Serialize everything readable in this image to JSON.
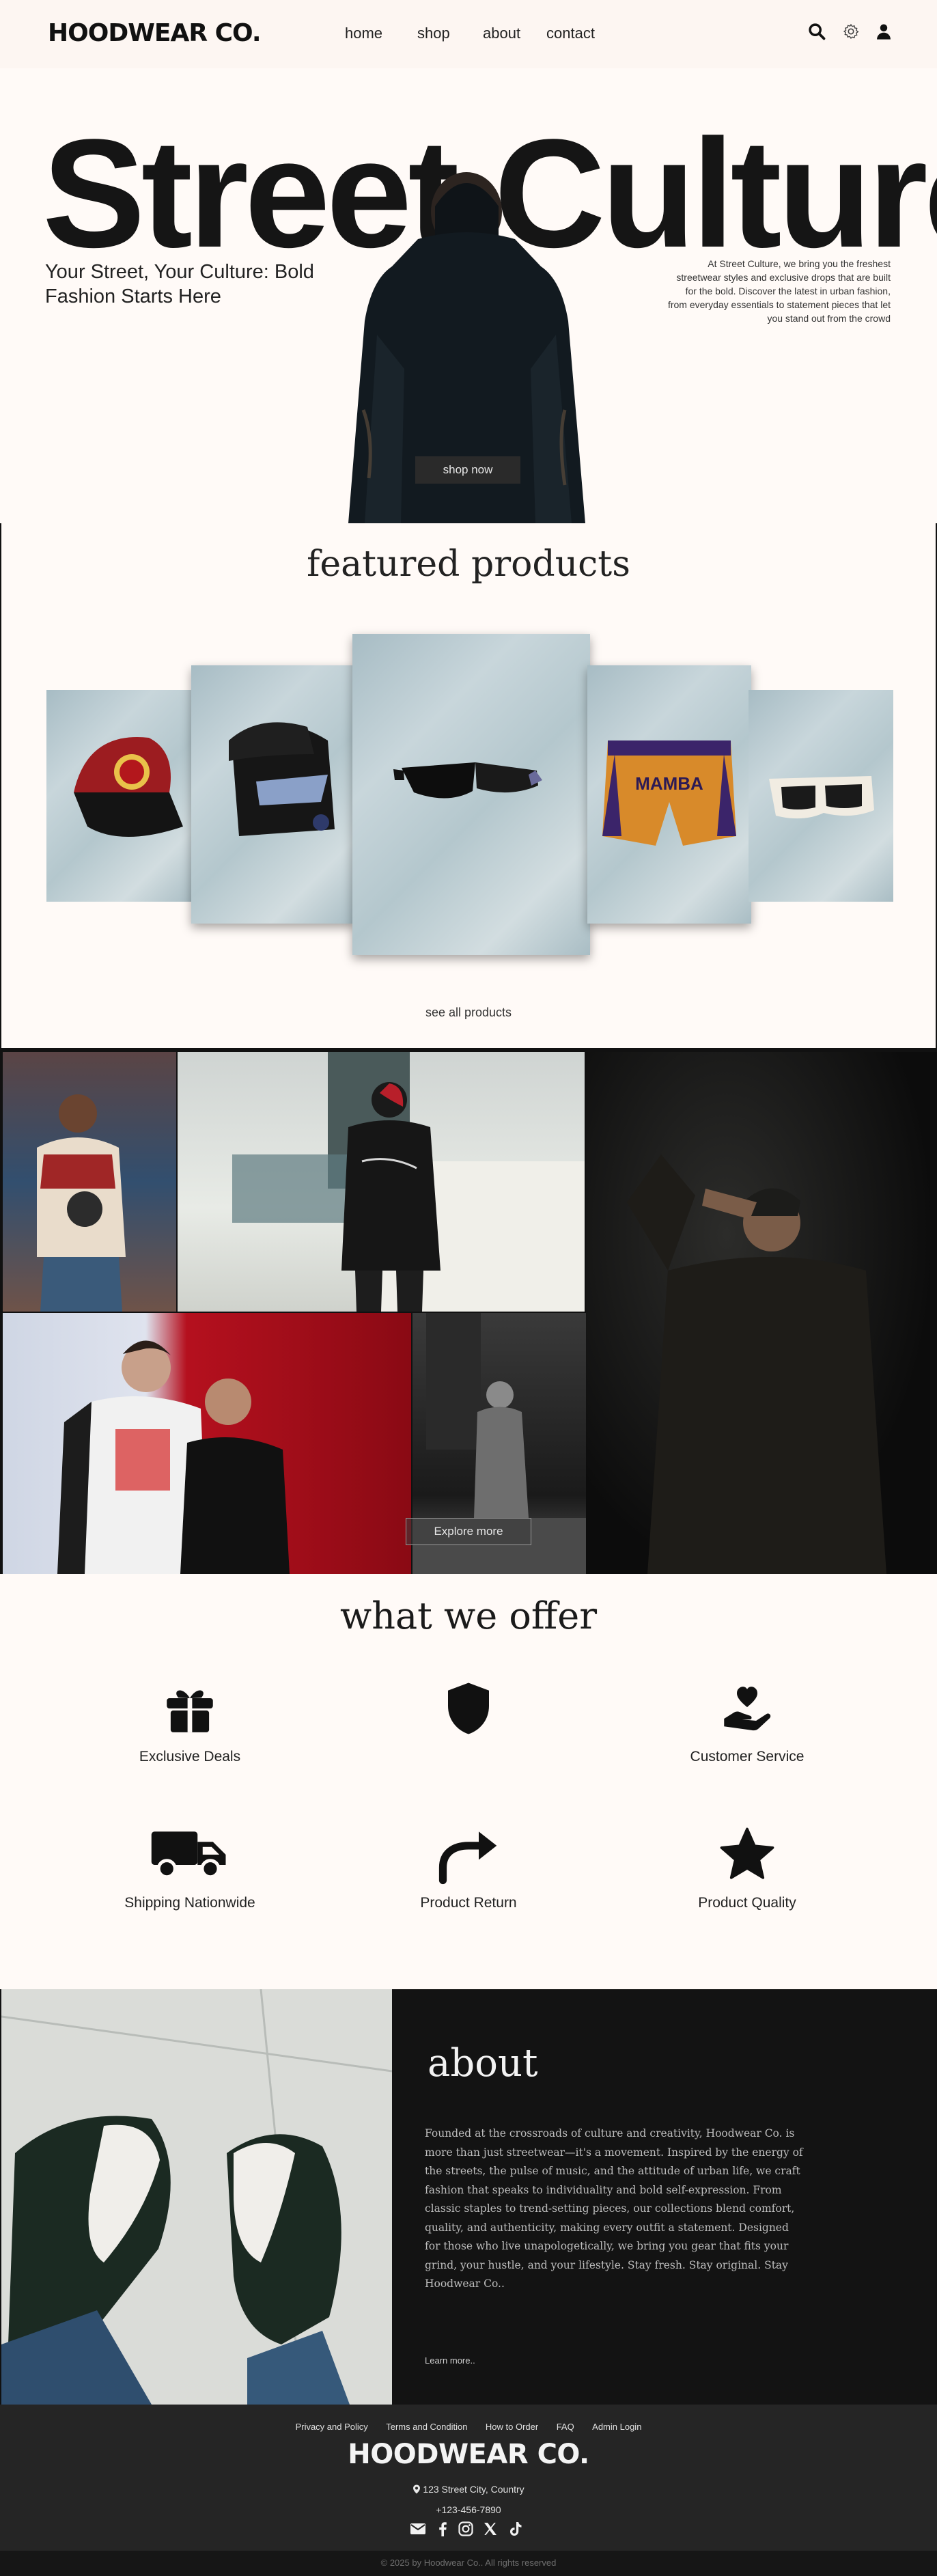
{
  "nav": {
    "brand": "HOODWEAR CO.",
    "links": [
      "home",
      "shop",
      "about",
      "contact"
    ],
    "icons": [
      "search-icon",
      "settings-icon",
      "user-icon"
    ]
  },
  "hero": {
    "title": "Street Culture",
    "subtitle": "Your Street, Your Culture: Bold Fashion Starts Here",
    "description": "At Street Culture, we bring you the freshest streetwear styles and exclusive drops that are built for the bold. Discover the latest in urban fashion, from everyday essentials to statement pieces that let you stand out from the crowd",
    "button": "shop now"
  },
  "featured": {
    "title": "featured products",
    "products": [
      "red snapback cap",
      "black snapback cap",
      "black sunglasses",
      "purple and orange basketball shorts",
      "white sunglasses"
    ],
    "see_all": "see all products"
  },
  "gallery": {
    "button": "Explore more"
  },
  "offer": {
    "title": "what we offer",
    "items": [
      {
        "label": "Exclusive Deals",
        "icon": "gift-icon"
      },
      {
        "label": "",
        "icon": "shield-icon"
      },
      {
        "label": "Customer Service",
        "icon": "heart-hand-icon"
      },
      {
        "label": "Shipping Nationwide",
        "icon": "truck-icon"
      },
      {
        "label": "Product Return",
        "icon": "return-arrow-icon"
      },
      {
        "label": "Product Quality",
        "icon": "star-icon"
      }
    ]
  },
  "about": {
    "title": "about",
    "text": "Founded at the crossroads of culture and creativity, Hoodwear Co. is more than just streetwear—it's a movement. Inspired by the energy of the streets, the pulse of music, and the attitude of urban life, we craft fashion that speaks to individuality and bold self-expression. From classic staples to trend-setting pieces, our collections blend comfort, quality, and authenticity, making every outfit a statement. Designed for those who live unapologetically, we bring you gear that fits your grind, your hustle, and your lifestyle. Stay fresh. Stay original. Stay Hoodwear Co..",
    "link": "Learn more.."
  },
  "footer": {
    "links": [
      "Privacy and Policy",
      "Terms and Condition",
      "How to Order",
      "FAQ",
      "Admin Login"
    ],
    "brand": "HOODWEAR CO.",
    "address": "123 Street City, Country",
    "phone": "+123-456-7890",
    "socials": [
      "email-icon",
      "facebook-icon",
      "instagram-icon",
      "x-icon",
      "tiktok-icon"
    ],
    "copyright": "© 2025 by Hoodwear Co.. All rights reserved"
  },
  "colors": {
    "background": "#fffaf7",
    "dark": "#131313",
    "footer": "#252525",
    "card": "#b9cbd1"
  }
}
